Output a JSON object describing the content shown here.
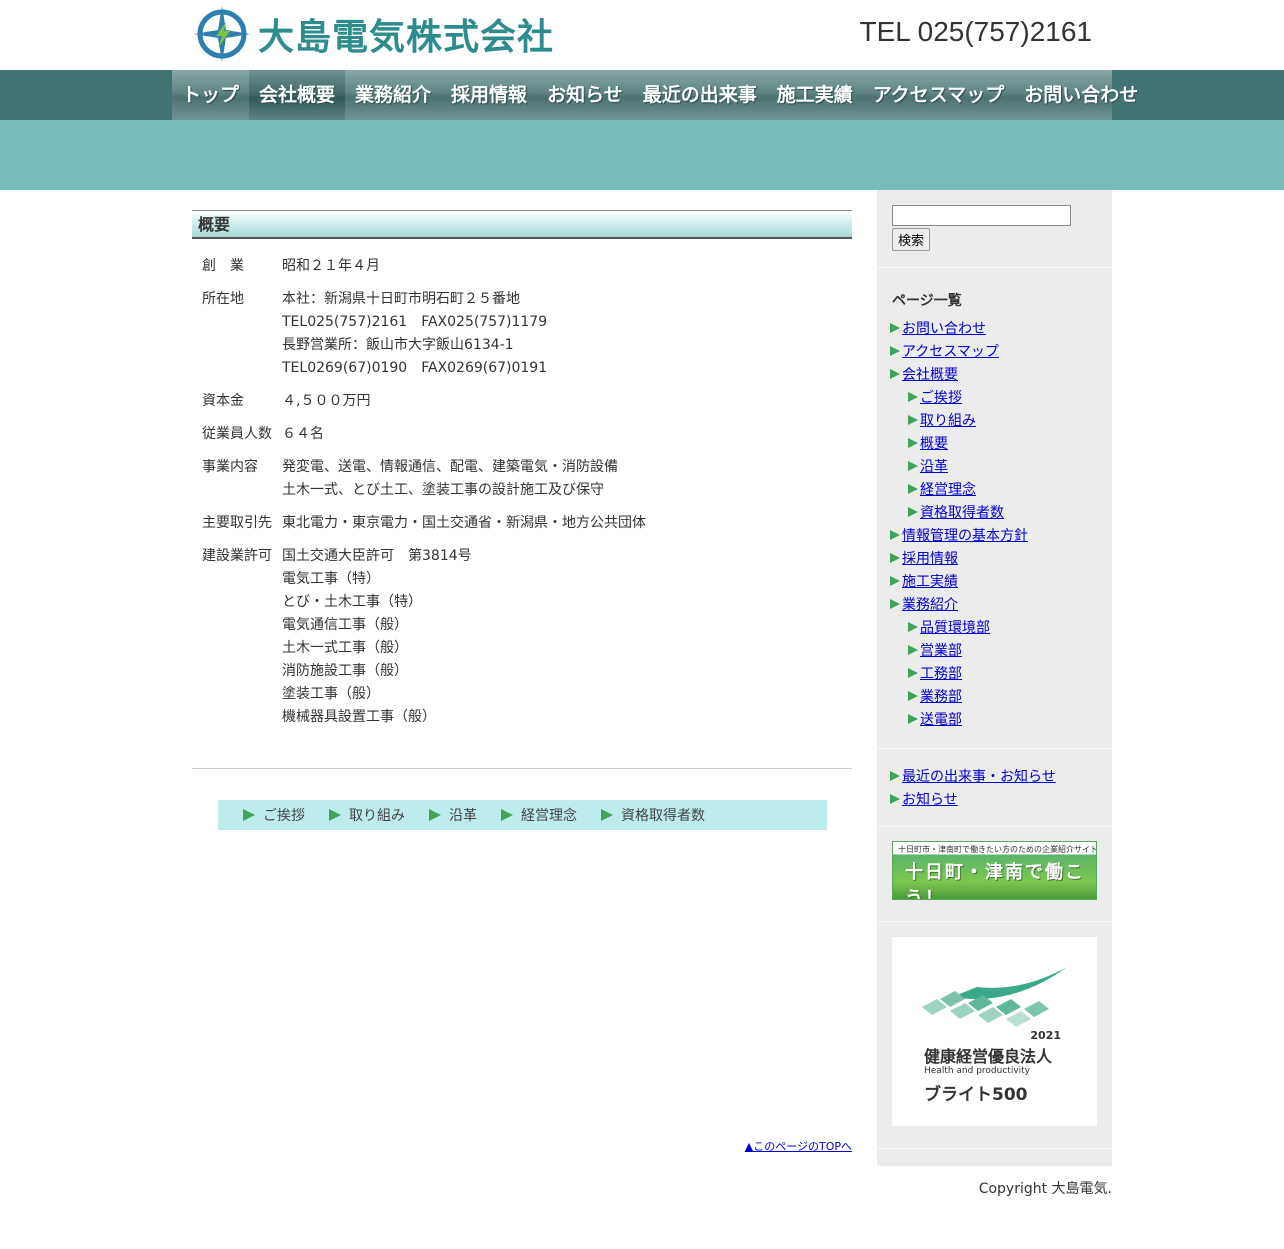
{
  "header": {
    "company_name": "大島電気株式会社",
    "tel": "TEL 025(757)2161"
  },
  "nav": [
    {
      "label": "トップ"
    },
    {
      "label": "会社概要",
      "active": true
    },
    {
      "label": "業務紹介"
    },
    {
      "label": "採用情報"
    },
    {
      "label": "お知らせ"
    },
    {
      "label": "最近の出来事"
    },
    {
      "label": "施工実績"
    },
    {
      "label": "アクセスマップ"
    },
    {
      "label": "お問い合わせ"
    }
  ],
  "main": {
    "section_title": "概要",
    "rows": [
      {
        "label": "創　業",
        "lines": [
          "昭和２１年４月"
        ]
      },
      {
        "label": "所在地",
        "lines": [
          "本社：新潟県十日町市明石町２５番地",
          "TEL025(757)2161　FAX025(757)1179",
          "長野営業所：飯山市大字飯山6134-1",
          "TEL0269(67)0190　FAX0269(67)0191"
        ]
      },
      {
        "label": "資本金",
        "lines": [
          "４,５００万円"
        ]
      },
      {
        "label": "従業員人数",
        "lines": [
          "６４名"
        ]
      },
      {
        "label": "事業内容",
        "lines": [
          "発変電、送電、情報通信、配電、建築電気・消防設備",
          "土木一式、とび土工、塗装工事の設計施工及び保守"
        ]
      },
      {
        "label": "主要取引先",
        "lines": [
          "東北電力・東京電力・国土交通省・新潟県・地方公共団体"
        ]
      },
      {
        "label": "建設業許可",
        "lines": [
          "国土交通大臣許可　第3814号",
          "電気工事（特）",
          "とび・土木工事（特）",
          "電気通信工事（般）",
          "土木一式工事（般）",
          "消防施設工事（般）",
          "塗装工事（般）",
          "機械器具設置工事（般）"
        ]
      }
    ],
    "subnav": [
      "ご挨拶",
      "取り組み",
      "沿革",
      "経営理念",
      "資格取得者数"
    ],
    "page_top": "▲このページのTOPへ"
  },
  "sidebar": {
    "search_button": "検索",
    "search_value": "",
    "pages_title": "ページ一覧",
    "pages": [
      {
        "label": "お問い合わせ",
        "sub": false
      },
      {
        "label": "アクセスマップ",
        "sub": false
      },
      {
        "label": "会社概要",
        "sub": false
      },
      {
        "label": "ご挨拶",
        "sub": true
      },
      {
        "label": "取り組み",
        "sub": true
      },
      {
        "label": "概要",
        "sub": true
      },
      {
        "label": "沿革",
        "sub": true
      },
      {
        "label": "経営理念",
        "sub": true
      },
      {
        "label": "資格取得者数",
        "sub": true
      },
      {
        "label": "情報管理の基本方針",
        "sub": false
      },
      {
        "label": "採用情報",
        "sub": false
      },
      {
        "label": "施工実績",
        "sub": false
      },
      {
        "label": "業務紹介",
        "sub": false
      },
      {
        "label": "品質環境部",
        "sub": true
      },
      {
        "label": "営業部",
        "sub": true
      },
      {
        "label": "工務部",
        "sub": true
      },
      {
        "label": "業務部",
        "sub": true
      },
      {
        "label": "送電部",
        "sub": true
      }
    ],
    "news_links": [
      "最近の出来事・お知らせ",
      "お知らせ"
    ],
    "banner1": {
      "small_text": "十日町市・津南町で働きたい方のための企業紹介サイト",
      "big_text": "十日町・津南で働こう！"
    },
    "banner2": {
      "year": "2021",
      "title": "健康経営優良法人",
      "english": "Health and productivity",
      "brand": "ブライト500"
    }
  },
  "footer": {
    "copyright": "Copyright 大島電気."
  },
  "colors": {
    "nav_bg": "#3f7473",
    "band": "#78bbb9",
    "subnav_bg": "#bdeced",
    "sidebar_bg": "#ececec",
    "arrow_green": "#3fa35a"
  }
}
